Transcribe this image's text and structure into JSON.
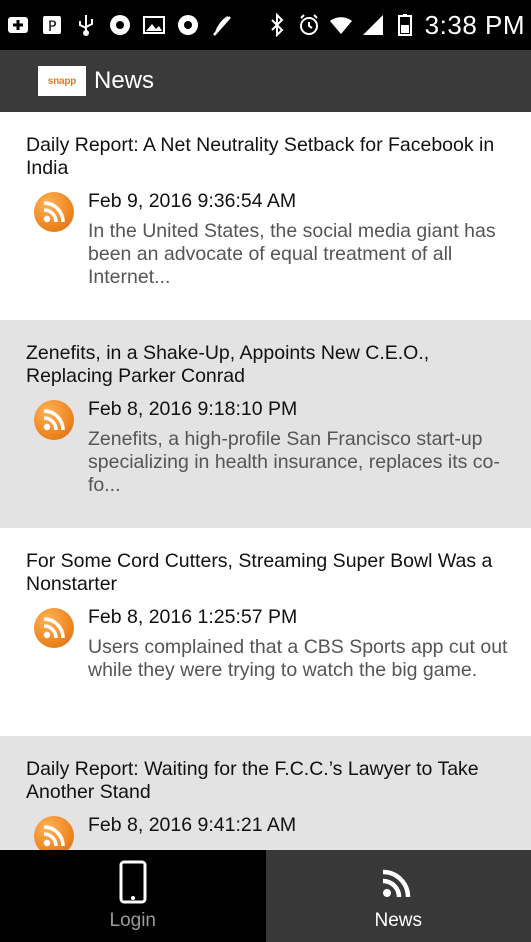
{
  "status_bar": {
    "time": "3:38 PM",
    "left_icons": [
      "add-box-icon",
      "notification-p-icon",
      "usb-icon",
      "photo-camera-icon",
      "image-icon",
      "photo-camera-icon",
      "edit-slash-icon"
    ],
    "right_icons": [
      "bluetooth-icon",
      "alarm-icon",
      "wifi-icon",
      "signal-icon",
      "battery-icon"
    ]
  },
  "app_bar": {
    "logo_text": "snapp",
    "title": "News"
  },
  "news": [
    {
      "title": "Daily Report: A Net Neutrality Setback for Facebook in India",
      "date": "Feb 9, 2016 9:36:54 AM",
      "snippet": "In the United States, the social media giant has been an advocate of equal treatment of all Internet..."
    },
    {
      "title": "Zenefits, in a Shake-Up, Appoints New C.E.O., Replacing Parker Conrad",
      "date": "Feb 8, 2016 9:18:10 PM",
      "snippet": "Zenefits, a high-profile San Francisco start-up specializing in health insurance, replaces its co-fo..."
    },
    {
      "title": "For Some Cord Cutters, Streaming Super Bowl Was a Nonstarter",
      "date": "Feb 8, 2016 1:25:57 PM",
      "snippet": "Users complained that a CBS Sports app cut out while they were trying to watch the big game."
    },
    {
      "title": "Daily Report: Waiting for the F.C.C.’s Lawyer to Take Another Stand",
      "date": "Feb 8, 2016 9:41:21 AM",
      "snippet": ""
    }
  ],
  "bottom_nav": {
    "login_label": "Login",
    "news_label": "News"
  },
  "colors": {
    "app_bar": "#3a3a3a",
    "alt_row": "#e3e3e3",
    "rss_orange": "#f08a24",
    "active_tab": "#383838"
  }
}
